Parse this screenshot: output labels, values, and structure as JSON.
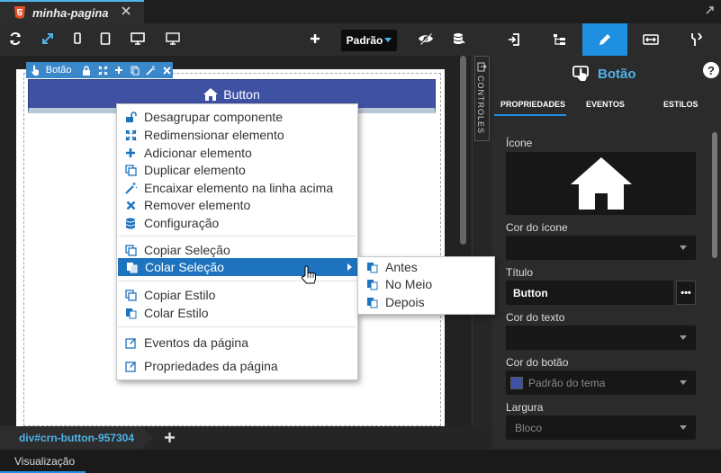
{
  "tab": {
    "title": "minha-pagina"
  },
  "toolbar": {
    "theme_select": "Padrão"
  },
  "component": {
    "toolbar_label": "Botão",
    "button_text": "Button"
  },
  "side_strip": {
    "label": "CONTROLES"
  },
  "context_menu": {
    "items": [
      {
        "label": "Desagrupar componente",
        "icon": "unlock-icon"
      },
      {
        "label": "Redimensionar elemento",
        "icon": "resize-icon"
      },
      {
        "label": "Adicionar elemento",
        "icon": "plus-icon"
      },
      {
        "label": "Duplicar elemento",
        "icon": "copy-icon"
      },
      {
        "label": "Encaixar elemento na linha acima",
        "icon": "magic-wand-icon"
      },
      {
        "label": "Remover elemento",
        "icon": "close-icon"
      },
      {
        "label": "Configuração",
        "icon": "database-icon"
      },
      {
        "label": "Copiar Seleção",
        "icon": "copy-icon"
      },
      {
        "label": "Colar Seleção",
        "icon": "paste-icon"
      },
      {
        "label": "Copiar Estilo",
        "icon": "copy-icon"
      },
      {
        "label": "Colar Estilo",
        "icon": "paste-icon"
      },
      {
        "label": "Eventos da página",
        "icon": "edit-icon"
      },
      {
        "label": "Propriedades da página",
        "icon": "edit-icon"
      }
    ],
    "submenu": [
      {
        "label": "Antes"
      },
      {
        "label": "No Meio"
      },
      {
        "label": "Depois"
      }
    ]
  },
  "bottom": {
    "path": "div#crn-button-957304",
    "status": "Visualização"
  },
  "panel": {
    "title": "Botão",
    "subtabs": [
      "PROPRIEDADES",
      "EVENTOS",
      "ESTILOS"
    ],
    "props": {
      "icone_label": "Ícone",
      "cor_icone_label": "Cor do ícone",
      "titulo_label": "Título",
      "titulo_value": "Button",
      "titulo_dots": "•••",
      "cor_texto_label": "Cor do texto",
      "cor_botao_label": "Cor do botão",
      "cor_botao_value": "Padrão do tema",
      "largura_label": "Largura",
      "largura_value": "Bloco"
    }
  },
  "colors": {
    "accent": "#1e8fe1",
    "highlight": "#1e73be",
    "button_bg": "#3f51a3",
    "theme_swatch": "#3f51a3"
  }
}
